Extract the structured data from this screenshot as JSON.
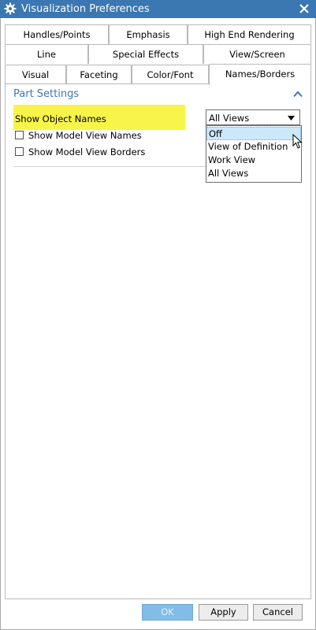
{
  "window": {
    "title": "Visualization Preferences"
  },
  "tabs": {
    "row1": [
      "Handles/Points",
      "Emphasis",
      "High End Rendering"
    ],
    "row2": [
      "Line",
      "Special Effects",
      "View/Screen"
    ],
    "row3": [
      "Visual",
      "Faceting",
      "Color/Font",
      "Names/Borders"
    ],
    "active": "Names/Borders"
  },
  "panel": {
    "section_title": "Part Settings",
    "show_object_names": {
      "label": "Show Object Names",
      "selected": "All Views",
      "options": [
        "Off",
        "View of Definition",
        "Work View",
        "All Views"
      ],
      "highlighted_option": "Off",
      "dropdown_open": true
    },
    "checkboxes": [
      {
        "label": "Show Model View Names",
        "checked": false
      },
      {
        "label": "Show Model View Borders",
        "checked": false
      }
    ]
  },
  "buttons": {
    "ok": "OK",
    "apply": "Apply",
    "cancel": "Cancel"
  },
  "colors": {
    "titlebar": "#3b77b0",
    "section_header": "#3d78b3",
    "highlight": "#f8f44a",
    "selected_option": "#cde8fb",
    "ok_button": "#81bde6"
  },
  "icons": {
    "title": "gear-icon",
    "close": "close-icon",
    "collapse": "chevron-up-icon",
    "dropdown": "dropdown-arrow-icon",
    "pointer": "mouse-cursor-icon"
  }
}
